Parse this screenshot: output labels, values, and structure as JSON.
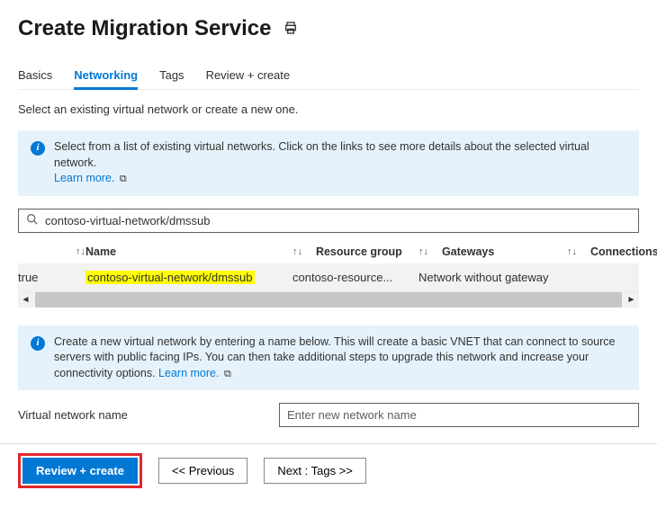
{
  "header": {
    "title": "Create Migration Service"
  },
  "tabs": [
    {
      "label": "Basics",
      "active": false
    },
    {
      "label": "Networking",
      "active": true
    },
    {
      "label": "Tags",
      "active": false
    },
    {
      "label": "Review + create",
      "active": false
    }
  ],
  "description": "Select an existing virtual network or create a new one.",
  "info1": {
    "text": "Select from a list of existing virtual networks. Click on the links to see more details about the selected virtual network.",
    "learn_more": "Learn more."
  },
  "search": {
    "value": "contoso-virtual-network/dmssub"
  },
  "table": {
    "headers": {
      "name": "Name",
      "resource_group": "Resource group",
      "gateways": "Gateways",
      "connections": "Connections"
    },
    "rows": [
      {
        "selected": "true",
        "name": "contoso-virtual-network/dmssub",
        "resource_group": "contoso-resource...",
        "gateways": "Network without gateway",
        "connections": ""
      }
    ]
  },
  "info2": {
    "text": "Create a new virtual network by entering a name below. This will create a basic VNET that can connect to source servers with public facing IPs. You can then take additional steps to upgrade this network and increase your connectivity options.",
    "learn_more": "Learn more."
  },
  "vnet_field": {
    "label": "Virtual network name",
    "placeholder": "Enter new network name",
    "value": ""
  },
  "footer": {
    "review_create": "Review + create",
    "previous": "<< Previous",
    "next": "Next : Tags >>"
  }
}
